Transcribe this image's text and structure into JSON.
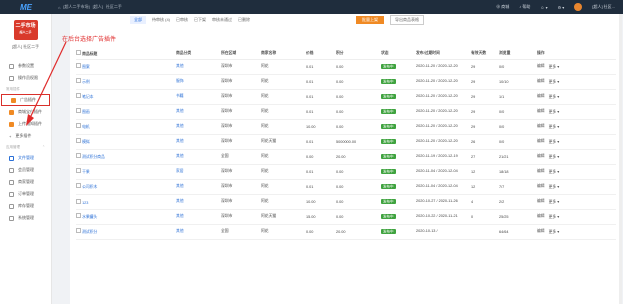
{
  "topbar": {
    "logo": "ME",
    "crumbs": [
      "[超人二手市场]",
      "[超人]",
      "社区二手"
    ],
    "btn1": "商城",
    "btn2": "帮助",
    "user": "[超人] 社区..."
  },
  "sidebar": {
    "store_logo": "二手市场",
    "store_sub": "超人二手",
    "store_name": "[超人] 社区二手",
    "items_top": [
      "参数设置",
      "操作员权限"
    ],
    "group_common": "常用插件",
    "plugins": [
      "广告插件",
      "商城宝付插件",
      "上传通知插件",
      "更多插件"
    ],
    "group_app": "应用管理",
    "apps": [
      "文件管理",
      "会员管理",
      "商家管理",
      "订单管理",
      "库存管理",
      "系统管理"
    ]
  },
  "callout": "在后台选择广告插件",
  "filters": {
    "tabs": [
      "全部",
      "待审核 (4)",
      "已审核",
      "已下架",
      "审核未通过",
      "已删除"
    ],
    "btn": "批量上架",
    "btn2": "导出商品表格"
  },
  "table": {
    "headers": [
      "商品标题",
      "商品分类",
      "所在区域",
      "商家名称",
      "价格",
      "积分",
      "状态",
      "发布/过期时间",
      "有效天数",
      "浏览量",
      "操作"
    ],
    "rows": [
      [
        "图案",
        "其他",
        "深圳市",
        "阿花",
        "0.01",
        "0.00",
        "发布中",
        "2020-11-20 / 2020-12-20",
        "29",
        "0/0"
      ],
      [
        "示例",
        "服饰",
        "深圳市",
        "阿花",
        "0.01",
        "0.00",
        "发布中",
        "2020-11-20 / 2020-12-20",
        "29",
        "10/10"
      ],
      [
        "笔记本",
        "书籍",
        "深圳市",
        "阿花",
        "0.01",
        "0.00",
        "发布中",
        "2020-11-20 / 2020-12-20",
        "29",
        "1/1"
      ],
      [
        "图画",
        "其他",
        "深圳市",
        "阿花",
        "0.01",
        "0.00",
        "发布中",
        "2020-11-20 / 2020-12-20",
        "29",
        "0/0"
      ],
      [
        "电机",
        "其他",
        "深圳市",
        "阿花",
        "10.00",
        "0.00",
        "发布中",
        "2020-11-20 / 2020-12-20",
        "29",
        "0/0"
      ],
      [
        "模拟",
        "其他",
        "深圳市",
        "阿花天猫",
        "0.01",
        "5000000.00",
        "发布中",
        "2020-11-20 / 2020-12-20",
        "26",
        "0/0"
      ],
      [
        "测试积分商品",
        "其他",
        "全国",
        "阿花",
        "0.00",
        "20.00",
        "发布中",
        "2020-11-19 / 2020-12-19",
        "27",
        "21/21"
      ],
      [
        "干果",
        "家居",
        "深圳市",
        "阿花",
        "0.01",
        "0.00",
        "发布中",
        "2020-11-04 / 2020-12-04",
        "12",
        "18/18"
      ],
      [
        "公司积木",
        "其他",
        "深圳市",
        "阿花",
        "0.01",
        "0.00",
        "发布中",
        "2020-11-04 / 2020-12-04",
        "12",
        "7/7"
      ],
      [
        "123",
        "其他",
        "深圳市",
        "阿花",
        "10.00",
        "0.00",
        "发布中",
        "2020-10-27 / 2020-11-26",
        "4",
        "2/2"
      ],
      [
        "水果罐头",
        "其他",
        "深圳市",
        "阿花天猫",
        "15.00",
        "0.00",
        "发布中",
        "2020-10-22 / 2020-11-21",
        "0",
        "25/25"
      ],
      [
        "测试积分",
        "其他",
        "全国",
        "阿花",
        "0.00",
        "20.00",
        "发布中",
        "2020-10-13 / ",
        "",
        "64/64"
      ]
    ],
    "op_edit": "编辑",
    "op_more": "更多"
  }
}
